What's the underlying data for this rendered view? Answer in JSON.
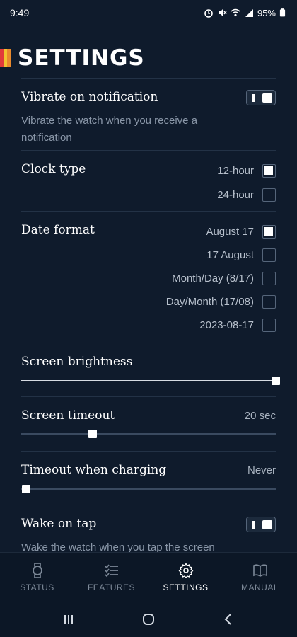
{
  "status_bar": {
    "time": "9:49",
    "battery": "95%"
  },
  "header": {
    "title": "SETTINGS",
    "stripe_colors": [
      "#e23b3b",
      "#f2c230",
      "#e98a2d"
    ]
  },
  "vibrate": {
    "title": "Vibrate on notification",
    "description": "Vibrate the watch when you receive a notification",
    "enabled": true
  },
  "clock_type": {
    "title": "Clock type",
    "options": [
      {
        "label": "12-hour",
        "checked": true
      },
      {
        "label": "24-hour",
        "checked": false
      }
    ]
  },
  "date_format": {
    "title": "Date format",
    "options": [
      {
        "label": "August 17",
        "checked": true
      },
      {
        "label": "17 August",
        "checked": false
      },
      {
        "label": "Month/Day (8/17)",
        "checked": false
      },
      {
        "label": "Day/Month (17/08)",
        "checked": false
      },
      {
        "label": "2023-08-17",
        "checked": false
      }
    ]
  },
  "brightness": {
    "title": "Screen brightness",
    "level": 1.0
  },
  "timeout": {
    "title": "Screen timeout",
    "value": "20 sec",
    "level": 0.28
  },
  "timeout_charging": {
    "title": "Timeout when charging",
    "value": "Never",
    "level": 0.02
  },
  "wake_on_tap": {
    "title": "Wake on tap",
    "description": "Wake the watch when you tap the screen",
    "enabled": true
  },
  "nav": {
    "items": [
      {
        "label": "STATUS",
        "icon": "watch-icon"
      },
      {
        "label": "FEATURES",
        "icon": "checklist-icon"
      },
      {
        "label": "SETTINGS",
        "icon": "gear-icon"
      },
      {
        "label": "MANUAL",
        "icon": "book-icon"
      }
    ],
    "active": "SETTINGS"
  },
  "system_nav": {
    "icons": [
      "recents-icon",
      "home-icon",
      "back-icon"
    ]
  },
  "colors": {
    "background": "#0f1b2c",
    "accent_text": "#ffffff",
    "muted_text": "#8a97a8"
  }
}
